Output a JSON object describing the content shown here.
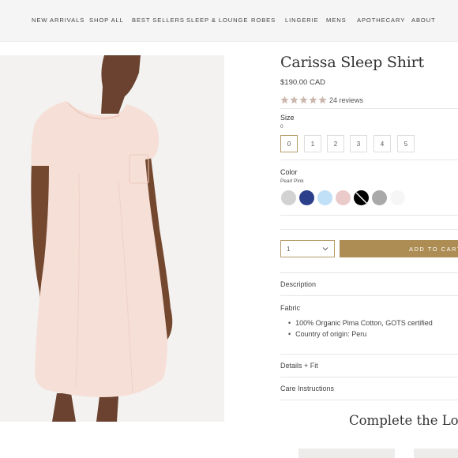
{
  "nav": {
    "items": [
      "NEW ARRIVALS",
      "SHOP ALL",
      "BEST SELLERS",
      "SLEEP & LOUNGE",
      "ROBES",
      "LINGERIE",
      "MENS",
      "APOTHECARY",
      "ABOUT"
    ]
  },
  "product": {
    "title": "Carissa Sleep Shirt",
    "price": "$190.00 CAD",
    "rating": 5,
    "reviews": "24 reviews"
  },
  "size": {
    "label": "Size",
    "selected": "0",
    "options": [
      "0",
      "1",
      "2",
      "3",
      "4",
      "5"
    ]
  },
  "color": {
    "label": "Color",
    "selected": "Pearl Pink",
    "swatches": [
      "#d2d2d2",
      "#2b3f8a",
      "#bfe0f6",
      "#ebcaca",
      "#000000",
      "#a9a9a9",
      "#f6f6f6"
    ]
  },
  "cart": {
    "quantity": "1",
    "add_label": "ADD TO CART"
  },
  "accordion": {
    "description": "Description",
    "fabric": "Fabric",
    "fabric_items": [
      "100% Organic Pima Cotton, GOTS certified",
      "Country of origin: Peru"
    ],
    "details": "Details + Fit",
    "care": "Care Instructions"
  },
  "recommend": {
    "title": "Complete the Look"
  },
  "colors": {
    "accent": "#ad8d54",
    "star": "#ccb7ad"
  }
}
